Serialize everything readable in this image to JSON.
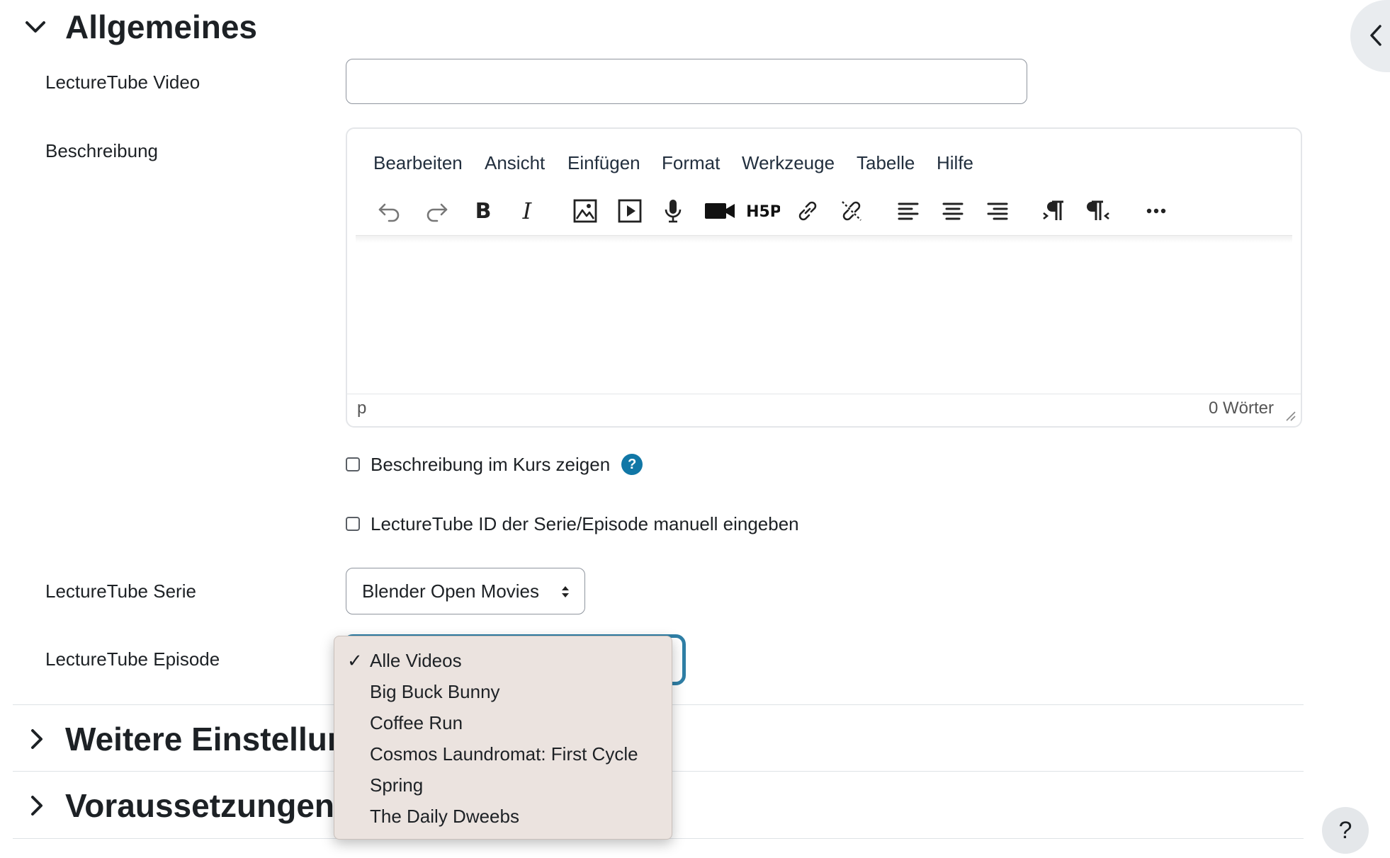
{
  "section_general": {
    "title": "Allgemeines"
  },
  "fields": {
    "video_label": "LectureTube Video",
    "video_value": "",
    "description_label": "Beschreibung",
    "series_label": "LectureTube Serie",
    "episode_label": "LectureTube Episode"
  },
  "editor": {
    "menu": [
      "Bearbeiten",
      "Ansicht",
      "Einfügen",
      "Format",
      "Werkzeuge",
      "Tabelle",
      "Hilfe"
    ],
    "toolbar_icons": [
      "undo-icon",
      "redo-icon",
      "bold-icon",
      "italic-icon",
      "image-icon",
      "media-icon",
      "microphone-icon",
      "video-camera-icon",
      "h5p-icon",
      "link-icon",
      "unlink-icon",
      "align-left-icon",
      "align-center-icon",
      "align-right-icon",
      "ltr-icon",
      "rtl-icon",
      "more-icon"
    ],
    "status_path": "p",
    "word_count": "0 Wörter"
  },
  "checkboxes": {
    "show_description": {
      "label": "Beschreibung im Kurs zeigen",
      "checked": false
    },
    "manual_id": {
      "label": "LectureTube ID der Serie/Episode manuell eingeben",
      "checked": false
    }
  },
  "series_select": {
    "value": "Blender Open Movies"
  },
  "episode_dropdown": {
    "selected": "Alle Videos",
    "options": [
      "Alle Videos",
      "Big Buck Bunny",
      "Coffee Run",
      "Cosmos Laundromat: First Cycle",
      "Spring",
      "The Daily Dweebs"
    ]
  },
  "collapsed_sections": [
    "Weitere Einstellungen",
    "Voraussetzungen"
  ],
  "floating_help": "?",
  "colors": {
    "accent": "#2f7fa6",
    "help_badge": "#1177a6",
    "dropdown_bg": "#ebe3df"
  }
}
